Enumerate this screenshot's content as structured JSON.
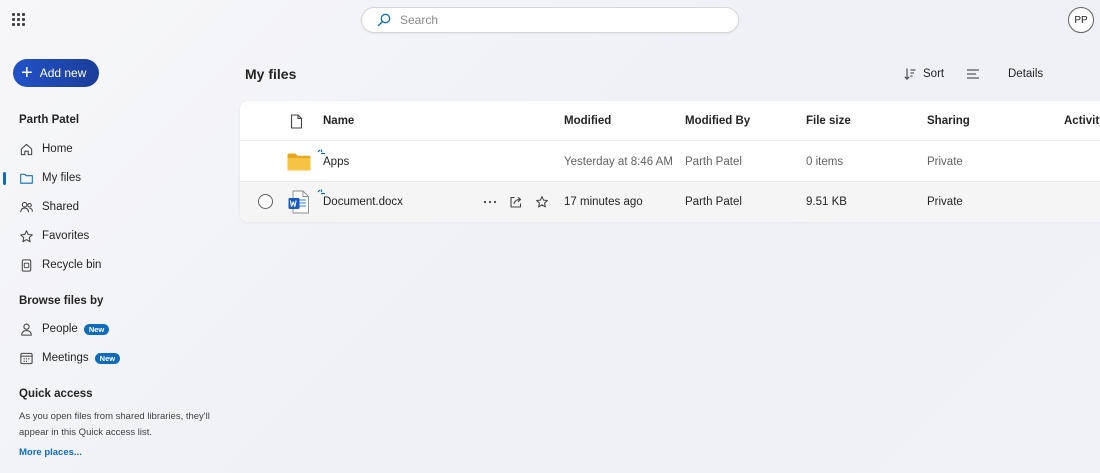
{
  "header": {
    "search_placeholder": "Search",
    "avatar_initials": "PP"
  },
  "sidebar": {
    "add_new_label": "Add new",
    "user_name": "Parth Patel",
    "nav": [
      {
        "label": "Home",
        "icon": "home-icon"
      },
      {
        "label": "My files",
        "icon": "folder-icon",
        "selected": true
      },
      {
        "label": "Shared",
        "icon": "people-icon"
      },
      {
        "label": "Favorites",
        "icon": "star-icon"
      },
      {
        "label": "Recycle bin",
        "icon": "trash-icon"
      }
    ],
    "browse_title": "Browse files by",
    "browse": [
      {
        "label": "People",
        "badge": "New",
        "icon": "person-icon"
      },
      {
        "label": "Meetings",
        "badge": "New",
        "icon": "calendar-icon"
      }
    ],
    "quick_access_title": "Quick access",
    "quick_access_text": "As you open files from shared libraries, they'll appear in this Quick access list.",
    "more_places": "More places..."
  },
  "main": {
    "title": "My files",
    "sort_label": "Sort",
    "details_label": "Details",
    "columns": [
      "Name",
      "Modified",
      "Modified By",
      "File size",
      "Sharing",
      "Activity"
    ],
    "files": [
      {
        "name": "Apps",
        "type": "folder",
        "modified": "Yesterday at 8:46 AM",
        "modified_by": "Parth Patel",
        "size": "0 items",
        "sharing": "Private"
      },
      {
        "name": "Document.docx",
        "type": "word",
        "modified": "17 minutes ago",
        "modified_by": "Parth Patel",
        "size": "9.51 KB",
        "sharing": "Private"
      }
    ]
  },
  "colors": {
    "accent": "#0f6cbd",
    "add_button": "#1f4ab5",
    "folder": "#f6c342"
  }
}
